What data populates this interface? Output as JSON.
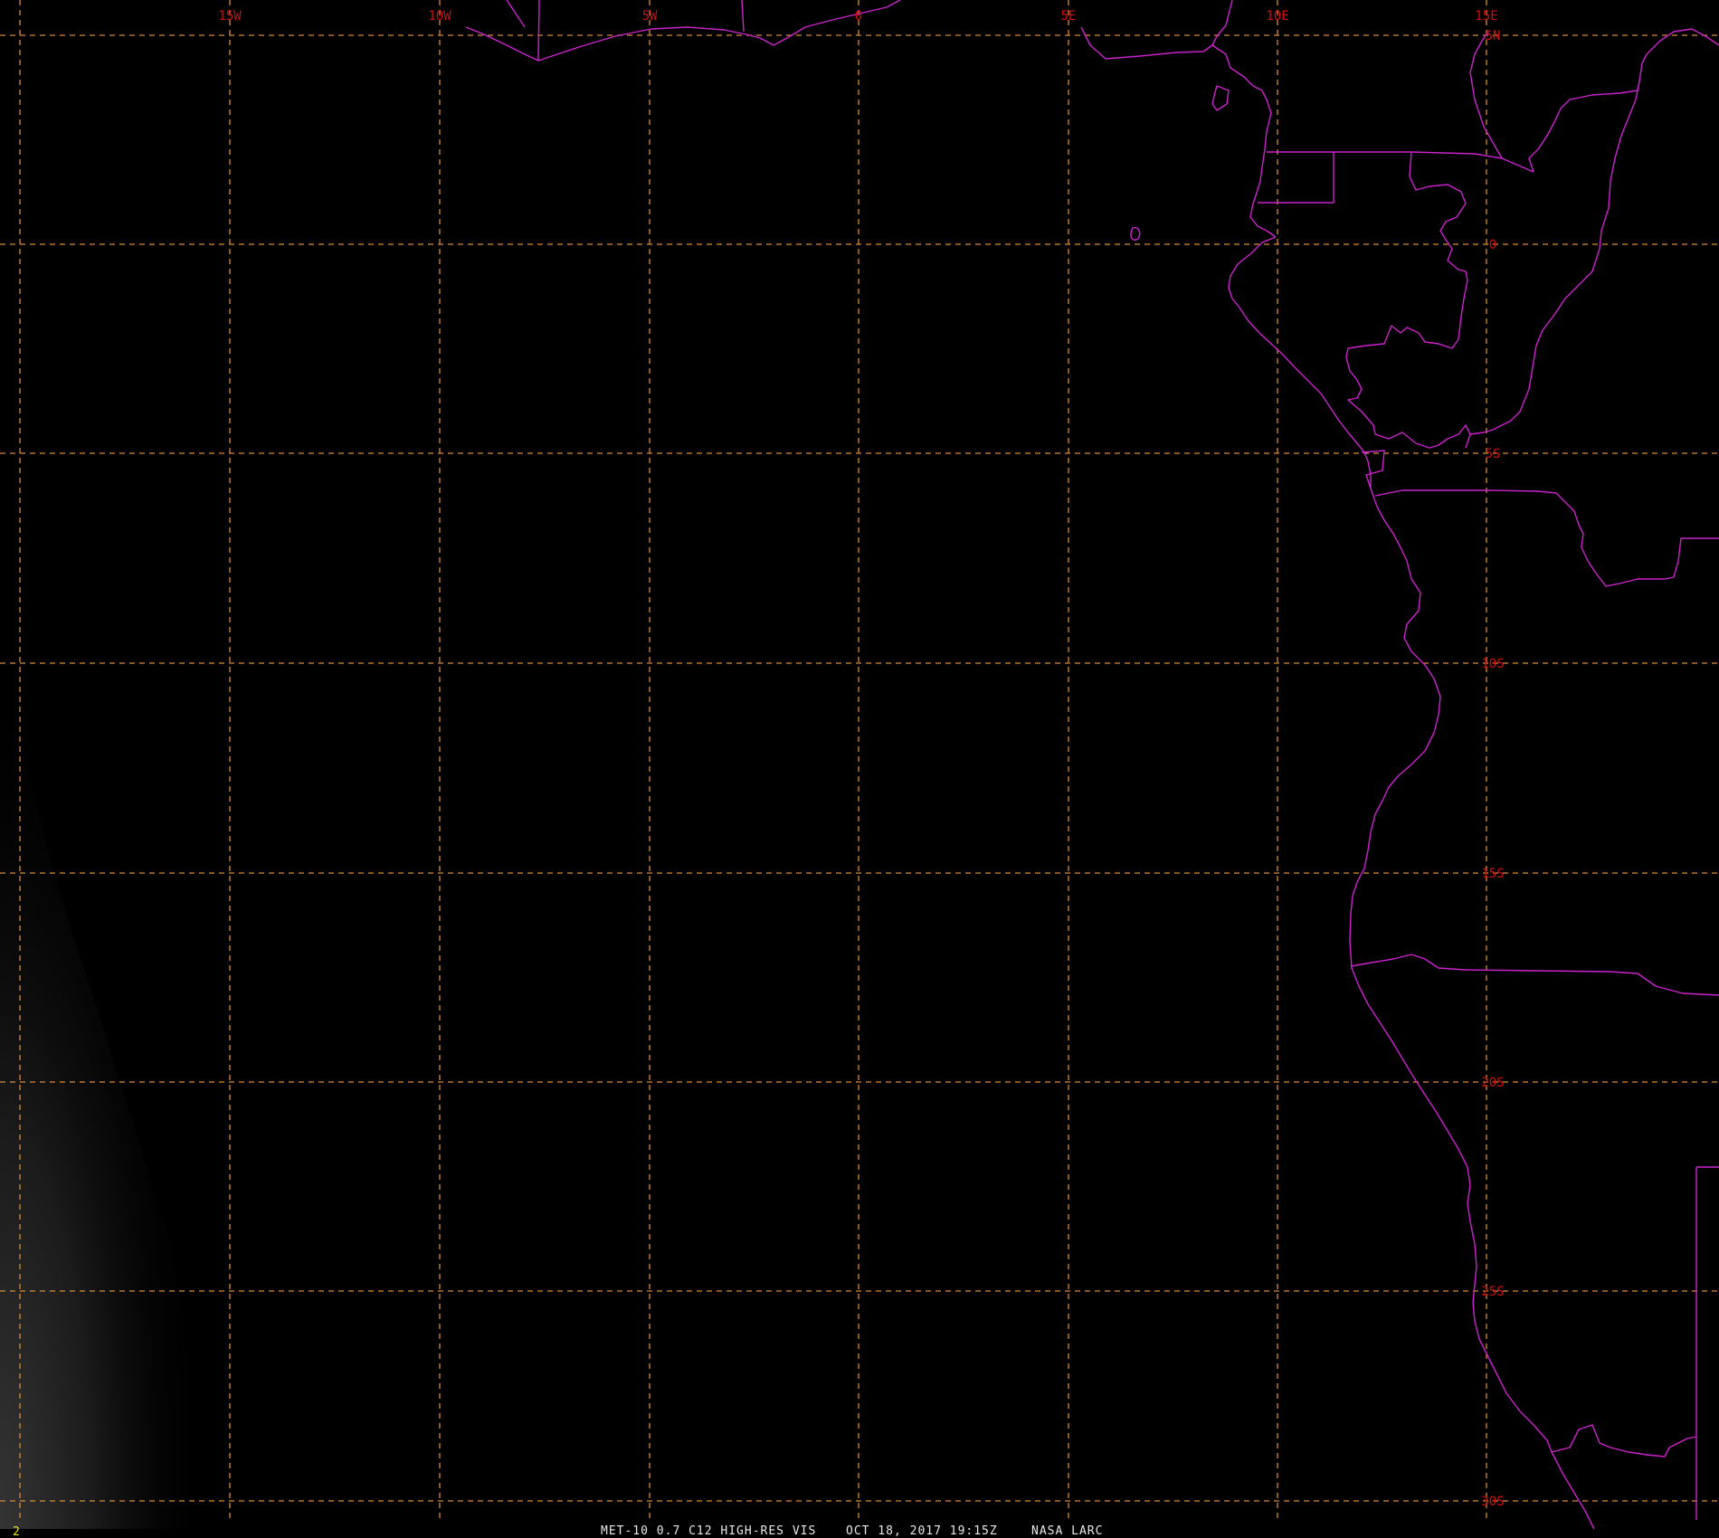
{
  "map": {
    "colors": {
      "background": "#000000",
      "graticule": "#d88a3a",
      "coastline": "#cc22cc",
      "label": "#d01010",
      "footer_text": "#e8e8e8",
      "frame_number": "#e8e800"
    },
    "longitude_labels": [
      "15W",
      "10W",
      "5W",
      "0",
      "5E",
      "10E",
      "15E"
    ],
    "latitude_labels": [
      "5N",
      "0",
      "5S",
      "10S",
      "15S",
      "20S",
      "25S",
      "30S"
    ],
    "footer": {
      "satellite": "MET-10 0.7 C12 HIGH-RES VIS",
      "datetime": "OCT 18, 2017 19:15Z",
      "source": "NASA LARC"
    },
    "frame_number": "2"
  }
}
